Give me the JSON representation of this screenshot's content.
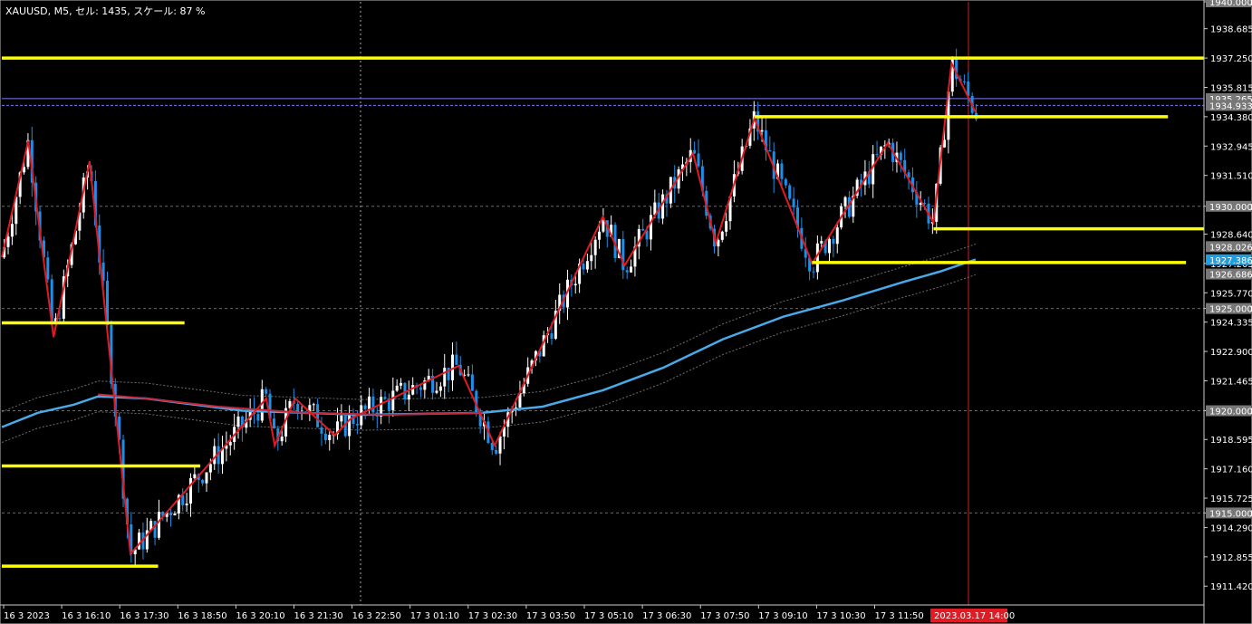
{
  "header": {
    "title": "XAUUSD, M5, セル: 1435, スケール: 87 %"
  },
  "colors": {
    "background": "#000000",
    "candle": "#ffffff",
    "candle_down": "#1e8fe8",
    "level": "#ffff00",
    "zigzag": "#e01b24",
    "ma_fast": "#4aa9e8",
    "ma_slow": "#c8283c",
    "band": "#6e6e6e",
    "grid": "#6a6a6a",
    "bid_line": "#7a7aff",
    "current_price_bg": "#1e9ee0",
    "time_marker_bg": "#e01b24",
    "time_marker_line": "#d02020"
  },
  "price_axis": {
    "min": 1910.5,
    "max": 1940.0,
    "labels": [
      "1940.000",
      "1938.685",
      "1937.250",
      "1935.815",
      "1934.380",
      "1932.945",
      "1931.510",
      "1930.000",
      "1928.640",
      "1927.205",
      "1925.770",
      "1925.000",
      "1924.335",
      "1922.900",
      "1921.465",
      "1920.000",
      "1918.595",
      "1917.160",
      "1915.725",
      "1915.000",
      "1914.290",
      "1912.855",
      "1911.420"
    ],
    "boxed_labels": [
      {
        "text": "1940.000",
        "price": 1940.0
      },
      {
        "text": "1935.265",
        "price": 1935.265
      },
      {
        "text": "1934.933",
        "price": 1934.933
      },
      {
        "text": "1930.000",
        "price": 1930.0
      },
      {
        "text": "1928.026",
        "price": 1928.026
      },
      {
        "text": "1926.686",
        "price": 1926.686
      },
      {
        "text": "1925.000",
        "price": 1925.0
      },
      {
        "text": "1920.000",
        "price": 1920.0
      },
      {
        "text": "1915.000",
        "price": 1915.0
      }
    ],
    "current_price": {
      "text": "1927.386",
      "price": 1927.386
    }
  },
  "time_axis": {
    "labels": [
      "16 3 2023",
      "16 3 16:10",
      "16 3 17:30",
      "16 3 18:50",
      "16 3 20:10",
      "16 3 21:30",
      "16 3 22:50",
      "17 3 01:10",
      "17 3 02:30",
      "17 3 03:50",
      "17 3 05:10",
      "17 3 06:30",
      "17 3 07:50",
      "17 3 09:10",
      "17 3 10:30",
      "17 3 11:50"
    ],
    "marker": "2023.03.17 14:00"
  },
  "chart_data": {
    "type": "candlestick",
    "symbol": "XAUUSD",
    "timeframe": "M5",
    "ylim": [
      1910.5,
      1940.0
    ],
    "horizontal_levels": [
      {
        "price": 1937.25,
        "x_start": 0.0,
        "x_end": 1.0
      },
      {
        "price": 1934.38,
        "x_start": 0.626,
        "x_end": 0.97
      },
      {
        "price": 1928.9,
        "x_start": 0.775,
        "x_end": 1.0
      },
      {
        "price": 1927.25,
        "x_start": 0.674,
        "x_end": 0.985
      },
      {
        "price": 1924.3,
        "x_start": 0.0,
        "x_end": 0.152
      },
      {
        "price": 1917.3,
        "x_start": 0.0,
        "x_end": 0.165
      },
      {
        "price": 1912.4,
        "x_start": 0.0,
        "x_end": 0.13
      }
    ],
    "zigzag": [
      {
        "x": 0.0,
        "p": 1927.5
      },
      {
        "x": 0.022,
        "p": 1933.2
      },
      {
        "x": 0.043,
        "p": 1923.6
      },
      {
        "x": 0.073,
        "p": 1932.2
      },
      {
        "x": 0.107,
        "p": 1913.0
      },
      {
        "x": 0.22,
        "p": 1920.6
      },
      {
        "x": 0.227,
        "p": 1918.3
      },
      {
        "x": 0.244,
        "p": 1920.6
      },
      {
        "x": 0.277,
        "p": 1918.8
      },
      {
        "x": 0.29,
        "p": 1919.6
      },
      {
        "x": 0.38,
        "p": 1922.2
      },
      {
        "x": 0.41,
        "p": 1918.3
      },
      {
        "x": 0.5,
        "p": 1929.5
      },
      {
        "x": 0.518,
        "p": 1927.1
      },
      {
        "x": 0.575,
        "p": 1932.6
      },
      {
        "x": 0.594,
        "p": 1928.2
      },
      {
        "x": 0.626,
        "p": 1934.3
      },
      {
        "x": 0.674,
        "p": 1927.2
      },
      {
        "x": 0.737,
        "p": 1933.1
      },
      {
        "x": 0.775,
        "p": 1929.2
      },
      {
        "x": 0.79,
        "p": 1937.0
      },
      {
        "x": 0.81,
        "p": 1934.6
      }
    ],
    "ma_fast": [
      {
        "x": 0.0,
        "p": 1919.2
      },
      {
        "x": 0.03,
        "p": 1919.9
      },
      {
        "x": 0.06,
        "p": 1920.3
      },
      {
        "x": 0.08,
        "p": 1920.7
      },
      {
        "x": 0.12,
        "p": 1920.6
      },
      {
        "x": 0.2,
        "p": 1920.0
      },
      {
        "x": 0.3,
        "p": 1919.8
      },
      {
        "x": 0.4,
        "p": 1919.9
      },
      {
        "x": 0.45,
        "p": 1920.2
      },
      {
        "x": 0.5,
        "p": 1921.0
      },
      {
        "x": 0.55,
        "p": 1922.1
      },
      {
        "x": 0.6,
        "p": 1923.5
      },
      {
        "x": 0.65,
        "p": 1924.6
      },
      {
        "x": 0.7,
        "p": 1925.4
      },
      {
        "x": 0.75,
        "p": 1926.3
      },
      {
        "x": 0.78,
        "p": 1926.8
      },
      {
        "x": 0.81,
        "p": 1927.4
      }
    ],
    "ma_slow": [
      {
        "x": 0.08,
        "p": 1920.8
      },
      {
        "x": 0.12,
        "p": 1920.6
      },
      {
        "x": 0.18,
        "p": 1920.2
      },
      {
        "x": 0.25,
        "p": 1919.9
      },
      {
        "x": 0.32,
        "p": 1919.8
      },
      {
        "x": 0.4,
        "p": 1919.9
      }
    ],
    "band_offset": 0.75
  }
}
